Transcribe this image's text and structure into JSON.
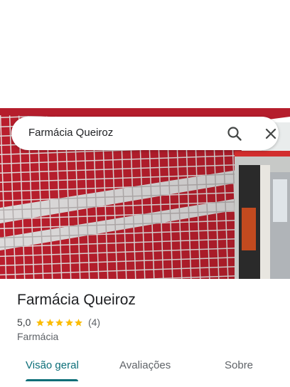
{
  "search": {
    "query": "Farmácia Queiroz",
    "search_icon": "search-icon",
    "close_icon": "close-icon"
  },
  "photo": {
    "subject": "storefront photo"
  },
  "place": {
    "name": "Farmácia Queiroz",
    "rating": "5,0",
    "stars": 5,
    "review_count": "(4)",
    "category": "Farmácia"
  },
  "tabs": [
    {
      "label": "Visão geral",
      "active": true
    },
    {
      "label": "Avaliações",
      "active": false
    },
    {
      "label": "Sobre",
      "active": false
    }
  ],
  "colors": {
    "accent": "#0b6e78",
    "star": "#fbbc04",
    "tile_red": "#c3202f",
    "grout": "#ece6e6"
  }
}
